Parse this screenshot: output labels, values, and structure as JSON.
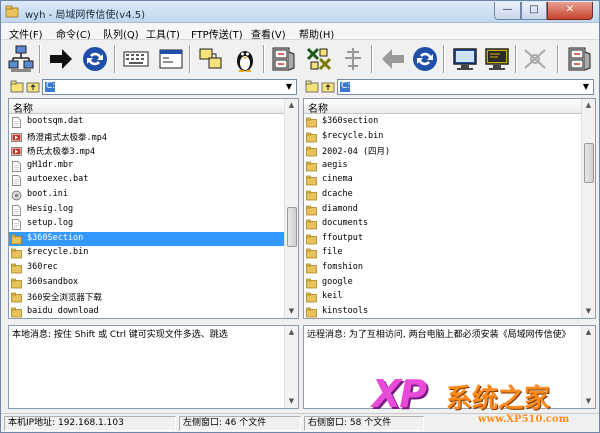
{
  "window": {
    "title": "wyh - 局域网传信使(v4.5)",
    "minimize": "—",
    "maximize": "□",
    "close": "✕"
  },
  "menu": [
    "文件(F)",
    "命令(C)",
    "队列(Q)",
    "工具(T)",
    "FTP传送(T)",
    "查看(V)",
    "帮助(H)"
  ],
  "toolbar_icons": {
    "left": [
      "network-computers-icon",
      "send-arrow-icon",
      "refresh-sync-icon",
      "keyboard-icon",
      "terminal-window-icon",
      "folders-icon",
      "penguin-icon",
      "file-cabinet-icon"
    ],
    "right": [
      "exchange-icon",
      "tower-icon",
      "back-arrow-icon",
      "refresh-sync-icon",
      "monitor-icon",
      "remote-monitor-icon",
      "disconnect-icon"
    ]
  },
  "left_pane": {
    "path_value": "C:\\",
    "column_header": "名称",
    "files": [
      {
        "name": "bootsqm.dat",
        "type": "file"
      },
      {
        "name": "杨澄甫式太极拳.mp4",
        "type": "video"
      },
      {
        "name": "杨氏太极拳3.mp4",
        "type": "video"
      },
      {
        "name": "gH1dr.mbr",
        "type": "file"
      },
      {
        "name": "autoexec.bat",
        "type": "file"
      },
      {
        "name": "boot.ini",
        "type": "config"
      },
      {
        "name": "Hesig.log",
        "type": "file"
      },
      {
        "name": "setup.log",
        "type": "file"
      },
      {
        "name": "$360Section",
        "type": "folder",
        "selected": true
      },
      {
        "name": "$recycle.bin",
        "type": "folder"
      },
      {
        "name": "360rec",
        "type": "folder"
      },
      {
        "name": "360sandbox",
        "type": "folder"
      },
      {
        "name": "360安全浏览器下载",
        "type": "folder"
      },
      {
        "name": "baidu download",
        "type": "folder"
      }
    ],
    "message": "本地消息: 按住 Shift 或 Ctrl 键可实现文件多选、跳选"
  },
  "right_pane": {
    "path_value": "C:\\",
    "column_header": "名称",
    "files": [
      {
        "name": "$360section",
        "type": "folder"
      },
      {
        "name": "$recycle.bin",
        "type": "folder"
      },
      {
        "name": "2002-04 (四月)",
        "type": "folder"
      },
      {
        "name": "aegis",
        "type": "folder"
      },
      {
        "name": "cinema",
        "type": "folder"
      },
      {
        "name": "dcache",
        "type": "folder"
      },
      {
        "name": "diamond",
        "type": "folder"
      },
      {
        "name": "documents",
        "type": "folder"
      },
      {
        "name": "ffoutput",
        "type": "folder"
      },
      {
        "name": "file",
        "type": "folder"
      },
      {
        "name": "fomshion",
        "type": "folder"
      },
      {
        "name": "google",
        "type": "folder"
      },
      {
        "name": "keil",
        "type": "folder"
      },
      {
        "name": "kinstools",
        "type": "folder"
      }
    ],
    "message": "远程消息: 为了互相访问, 两台电脑上都必须安装《局域网传信使》"
  },
  "status": {
    "ip": "本机IP地址: 192.168.1.103",
    "left_count": "左侧窗口: 46 个文件",
    "right_count": "右侧窗口: 58 个文件"
  },
  "watermark": {
    "logo": "XP",
    "name": "系统之家",
    "url": "www.XP510.com"
  },
  "colors": {
    "selection": "#3399ff",
    "folder": "#e8c25a",
    "accent_blue": "#1f4fa8"
  }
}
